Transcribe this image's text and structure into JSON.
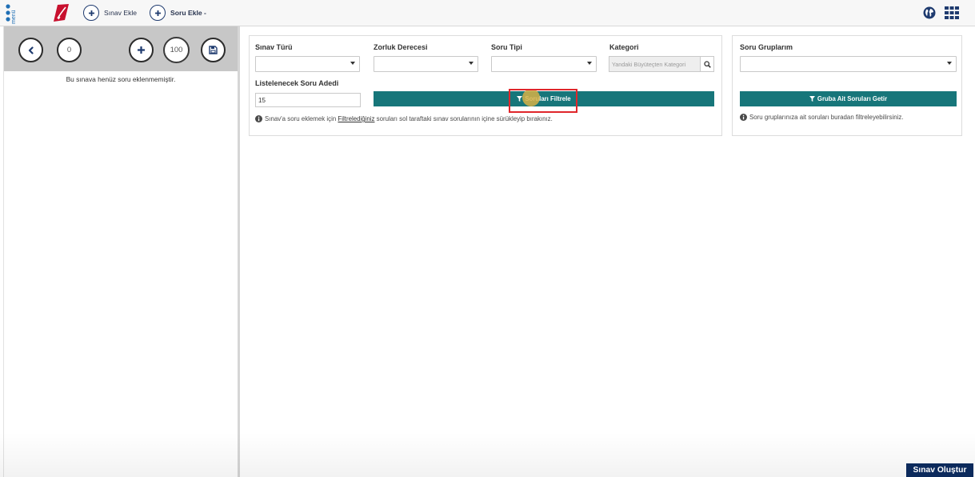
{
  "topbar": {
    "menu_label": "menü",
    "add_exam_label": "Sınav Ekle",
    "add_question_label": "Soru Ekle -"
  },
  "sidebar": {
    "question_count": "0",
    "total_points": "100",
    "empty_message": "Bu sınava henüz soru eklenmemiştir."
  },
  "filter_panel": {
    "exam_type_label": "Sınav Türü",
    "difficulty_label": "Zorluk Derecesi",
    "question_type_label": "Soru Tipi",
    "category_label": "Kategori",
    "category_placeholder": "Yandaki Büyüteçten Kategori",
    "count_label": "Listelenecek Soru Adedi",
    "count_value": "15",
    "filter_button_label": "Soruları Filtrele",
    "info_prefix": "Sınav'a soru eklemek için ",
    "info_link": "Filtrelediğiniz",
    "info_suffix": " soruları sol taraftaki sınav sorularının içine sürükleyip bırakınız."
  },
  "groups_panel": {
    "label": "Soru Gruplarım",
    "button_label": "Gruba Ait Soruları Getir",
    "info_text": "Soru gruplarınıza ait soruları buradan filtreleyebilirsiniz."
  },
  "footer": {
    "create_exam_label": "Sınav Oluştur"
  },
  "colors": {
    "accent_teal": "#17767a",
    "navy": "#0c2a5c",
    "icon_blue": "#1f3b6f",
    "brand_red": "#c8102e",
    "highlight_red": "#e0262b"
  },
  "icons": {
    "menu": "menu-icon",
    "logo": "logo-icon",
    "add": "plus-icon",
    "globe": "globe-icon",
    "apps": "grid-icon",
    "back": "chevron-left-icon",
    "save": "save-icon",
    "search": "search-icon",
    "filter": "filter-icon",
    "info": "info-icon",
    "dropdown": "dropdown-arrow-icon"
  }
}
